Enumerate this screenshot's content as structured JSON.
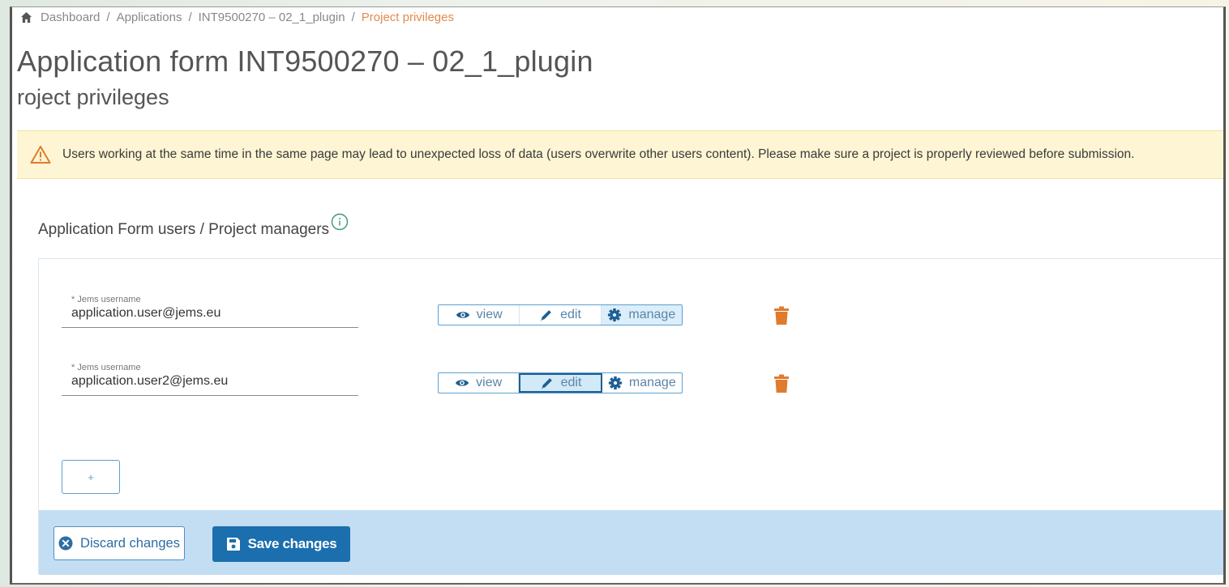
{
  "breadcrumb": {
    "items": [
      "Dashboard",
      "Applications",
      "INT9500270 – 02_1_plugin"
    ],
    "current": "Project privileges",
    "separator": "/"
  },
  "header": {
    "title": "Application form INT9500270 – 02_1_plugin",
    "subtitle": "roject privileges"
  },
  "warning": {
    "text": "Users working at the same time in the same page may lead to unexpected loss of data (users overwrite other users content). Please make sure a project is properly reviewed before submission."
  },
  "section": {
    "title": "Application Form users / Project managers"
  },
  "users": [
    {
      "label": "* Jems username",
      "value": "application.user@jems.eu",
      "selected": "manage"
    },
    {
      "label": "* Jems username",
      "value": "application.user2@jems.eu",
      "selected": "edit"
    }
  ],
  "permissions": {
    "view": "view",
    "edit": "edit",
    "manage": "manage"
  },
  "add_button": {
    "label": "+"
  },
  "footer": {
    "discard_label": "Discard changes",
    "save_label": "Save changes"
  },
  "colors": {
    "accent": "#1b6fae",
    "breadcrumb_current": "#e28a4b",
    "warning_bg": "#fdf5d3",
    "delete": "#e07b2e",
    "footer_bg": "#c3def2"
  },
  "icons": {
    "home": "home-icon",
    "warning": "warning-triangle-icon",
    "info": "info-circle-icon",
    "view": "eye-icon",
    "edit": "pencil-icon",
    "manage": "gear-icon",
    "delete": "trash-icon",
    "discard": "x-circle-icon",
    "save": "floppy-icon"
  }
}
